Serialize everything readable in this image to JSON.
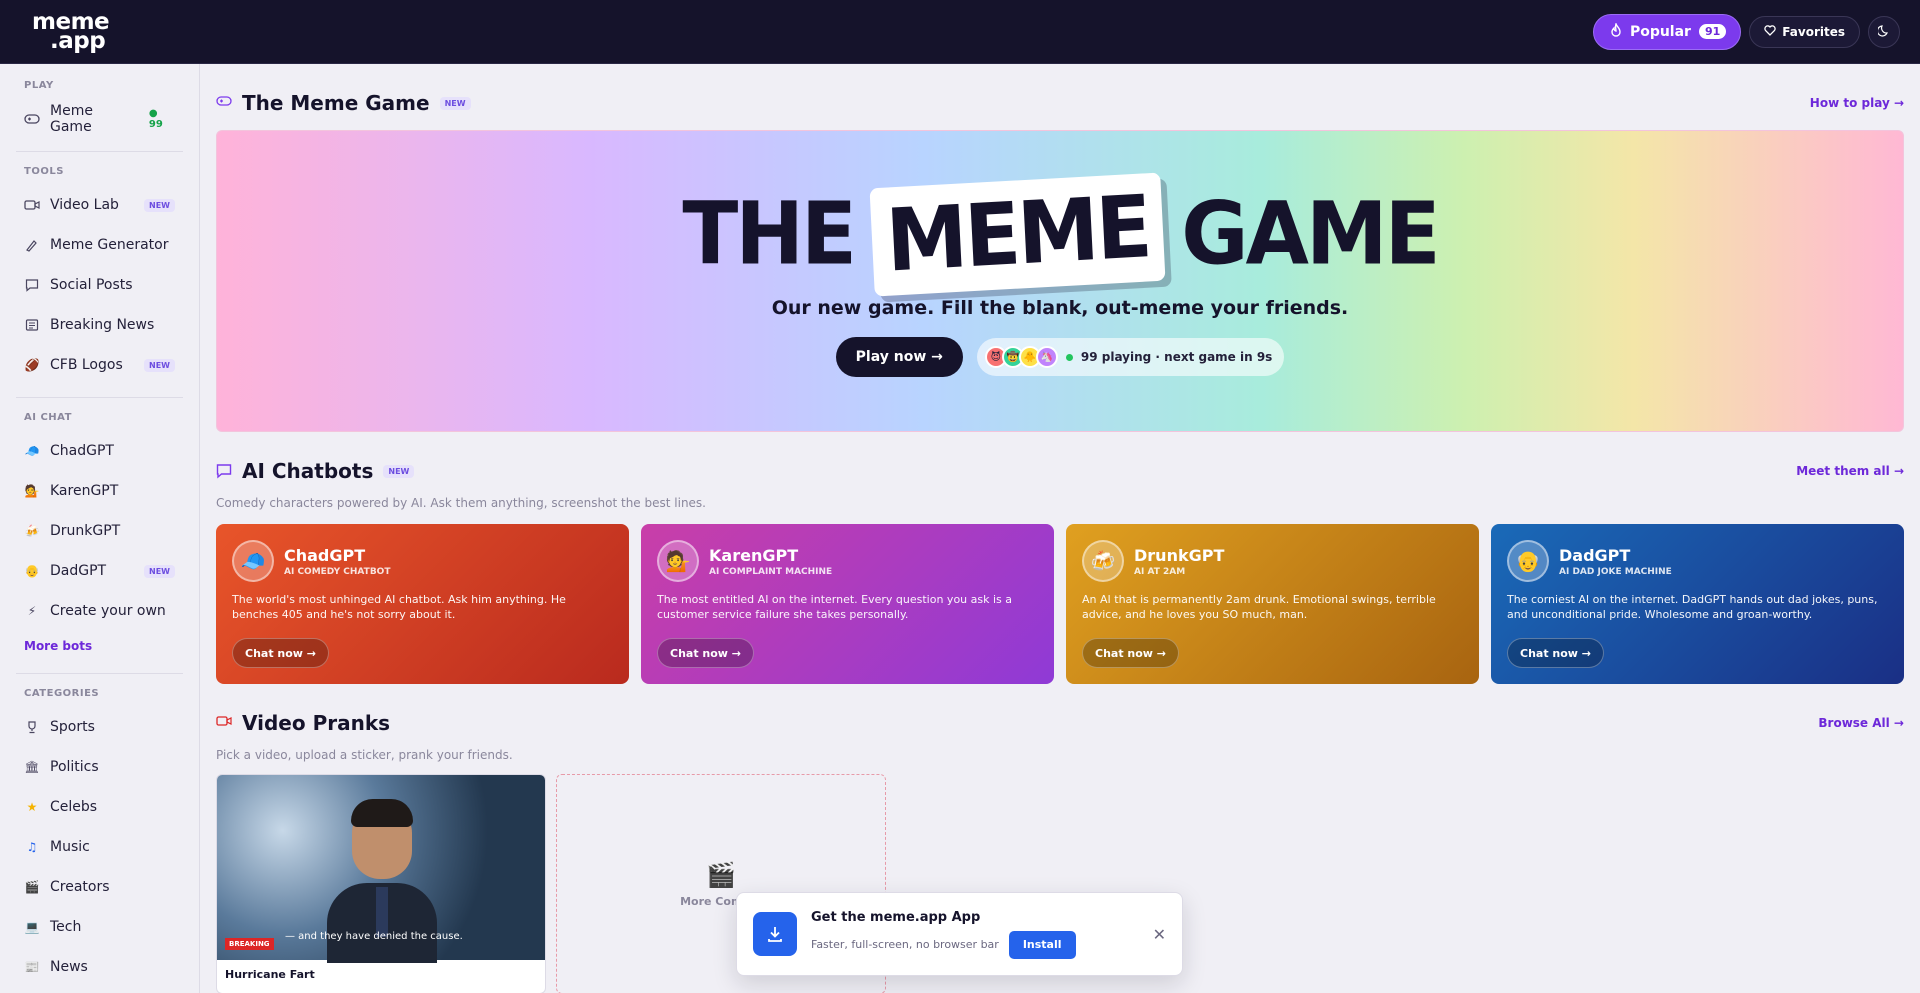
{
  "brand": {
    "line1": "meme",
    "line2": ".app"
  },
  "topbar": {
    "popular_label": "Popular",
    "popular_count": "91",
    "favorites_label": "Favorites"
  },
  "sidebar": {
    "play_label": "PLAY",
    "play_items": [
      {
        "label": "Meme Game",
        "live": "● 99",
        "icon": "gamepad-icon"
      }
    ],
    "tools_label": "TOOLS",
    "tools_items": [
      {
        "label": "Video Lab",
        "tag": "NEW",
        "icon": "video-icon"
      },
      {
        "label": "Meme Generator",
        "icon": "brush-icon"
      },
      {
        "label": "Social Posts",
        "icon": "chat-bubble-icon"
      },
      {
        "label": "Breaking News",
        "icon": "newspaper-icon"
      },
      {
        "label": "CFB Logos",
        "tag": "NEW",
        "icon": "football-icon"
      }
    ],
    "ai_label": "AI CHAT",
    "ai_items": [
      {
        "label": "ChadGPT",
        "icon": "cap-icon"
      },
      {
        "label": "KarenGPT",
        "icon": "karen-icon"
      },
      {
        "label": "DrunkGPT",
        "icon": "beer-icon"
      },
      {
        "label": "DadGPT",
        "tag": "NEW",
        "icon": "dad-icon"
      },
      {
        "label": "Create your own",
        "icon": "bolt-icon"
      }
    ],
    "more_bots": "More bots",
    "categories_label": "CATEGORIES",
    "categories": [
      {
        "label": "Sports",
        "icon": "trophy-icon"
      },
      {
        "label": "Politics",
        "icon": "bank-icon"
      },
      {
        "label": "Celebs",
        "icon": "star-icon"
      },
      {
        "label": "Music",
        "icon": "music-icon"
      },
      {
        "label": "Creators",
        "icon": "clapper-icon"
      },
      {
        "label": "Tech",
        "icon": "laptop-icon"
      },
      {
        "label": "News",
        "icon": "newspaper-icon"
      }
    ]
  },
  "meme_game": {
    "title": "The Meme Game",
    "tag": "NEW",
    "link": "How to play →",
    "hero_the": "THE",
    "hero_meme": "MEME",
    "hero_game": "GAME",
    "subtitle": "Our new game. Fill the blank, out-meme your friends.",
    "play_button": "Play now →",
    "status": "99 playing · next game in 9s"
  },
  "chatbots": {
    "title": "AI Chatbots",
    "tag": "NEW",
    "link": "Meet them all →",
    "subtitle": "Comedy characters powered by AI. Ask them anything, screenshot the best lines.",
    "bots": [
      {
        "name": "ChadGPT",
        "role": "AI COMEDY CHATBOT",
        "desc": "The world's most unhinged AI chatbot. Ask him anything. He benches 405 and he's not sorry about it.",
        "cta": "Chat now →",
        "avatar": "🧢"
      },
      {
        "name": "KarenGPT",
        "role": "AI COMPLAINT MACHINE",
        "desc": "The most entitled AI on the internet. Every question you ask is a customer service failure she takes personally.",
        "cta": "Chat now →",
        "avatar": "💁"
      },
      {
        "name": "DrunkGPT",
        "role": "AI AT 2AM",
        "desc": "An AI that is permanently 2am drunk. Emotional swings, terrible advice, and he loves you SO much, man.",
        "cta": "Chat now →",
        "avatar": "🍻"
      },
      {
        "name": "DadGPT",
        "role": "AI DAD JOKE MACHINE",
        "desc": "The corniest AI on the internet. DadGPT hands out dad jokes, puns, and unconditional pride. Wholesome and groan-worthy.",
        "cta": "Chat now →",
        "avatar": "👴"
      }
    ]
  },
  "pranks": {
    "title": "Video Pranks",
    "link": "Browse All →",
    "subtitle": "Pick a video, upload a sticker, prank your friends.",
    "video_title": "Hurricane Fart",
    "video_caption": "— and they have denied the cause.",
    "breaking": "BREAKING",
    "more_label": "More Coming"
  },
  "install": {
    "title": "Get the meme.app App",
    "desc": "Faster, full-screen, no browser bar",
    "button": "Install"
  }
}
